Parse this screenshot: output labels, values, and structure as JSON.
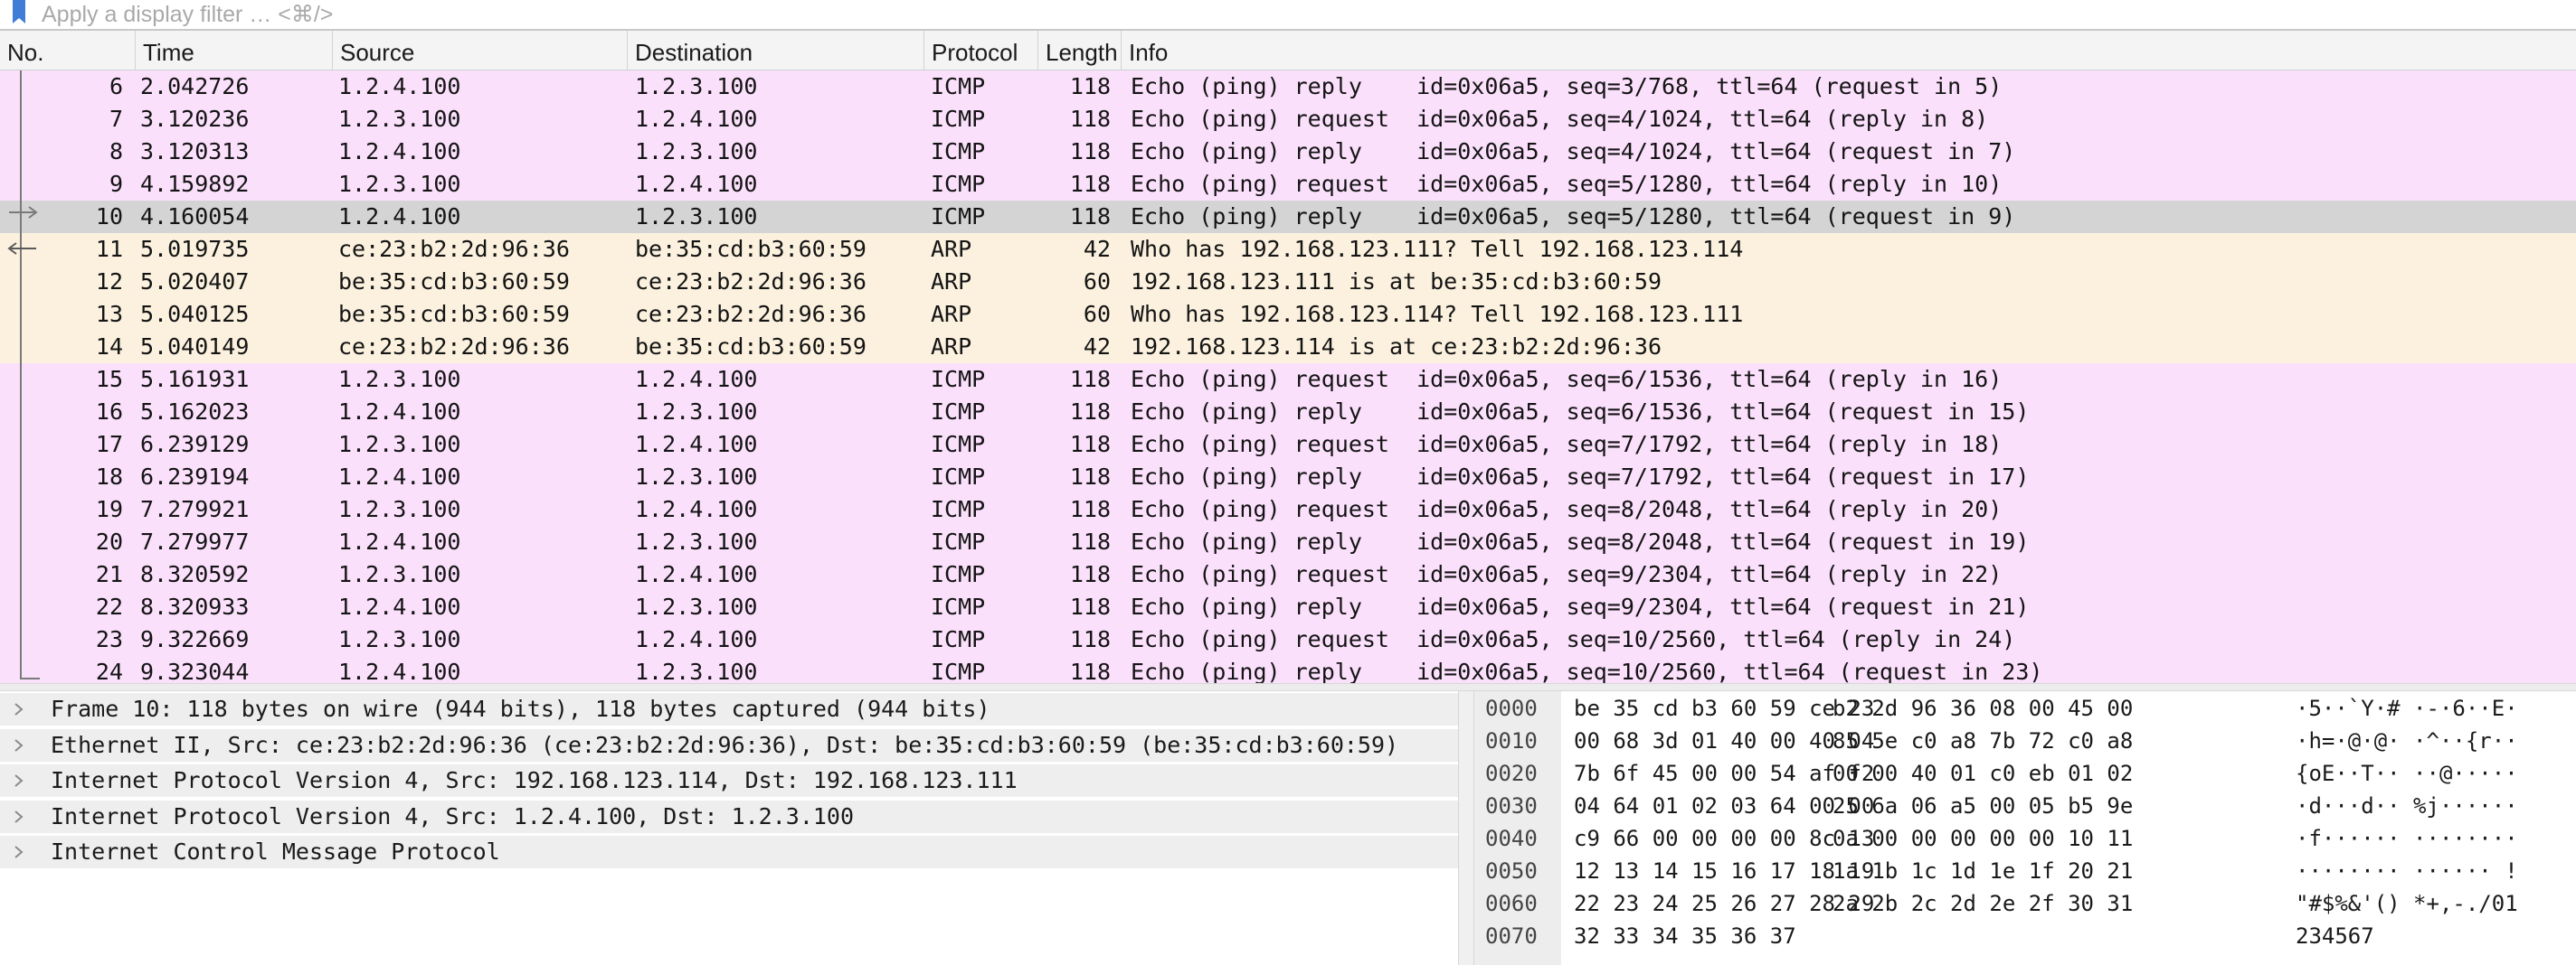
{
  "filter": {
    "placeholder": "Apply a display filter … <⌘/>",
    "bookmark_icon": "bookmark-icon"
  },
  "columns": {
    "no": "No.",
    "time": "Time",
    "source": "Source",
    "destination": "Destination",
    "protocol": "Protocol",
    "length": "Length",
    "info": "Info"
  },
  "colors": {
    "icmp_row": "#fbe0fc",
    "arp_row": "#fbf1de",
    "selected_row": "#d4d4d4"
  },
  "packets": [
    {
      "no": "6",
      "time": "2.042726",
      "src": "1.2.4.100",
      "dst": "1.2.3.100",
      "proto": "ICMP",
      "len": "118",
      "info": "Echo (ping) reply    id=0x06a5, seq=3/768, ttl=64 (request in 5)",
      "type": "icmp"
    },
    {
      "no": "7",
      "time": "3.120236",
      "src": "1.2.3.100",
      "dst": "1.2.4.100",
      "proto": "ICMP",
      "len": "118",
      "info": "Echo (ping) request  id=0x06a5, seq=4/1024, ttl=64 (reply in 8)",
      "type": "icmp"
    },
    {
      "no": "8",
      "time": "3.120313",
      "src": "1.2.4.100",
      "dst": "1.2.3.100",
      "proto": "ICMP",
      "len": "118",
      "info": "Echo (ping) reply    id=0x06a5, seq=4/1024, ttl=64 (request in 7)",
      "type": "icmp"
    },
    {
      "no": "9",
      "time": "4.159892",
      "src": "1.2.3.100",
      "dst": "1.2.4.100",
      "proto": "ICMP",
      "len": "118",
      "info": "Echo (ping) request  id=0x06a5, seq=5/1280, ttl=64 (reply in 10)",
      "type": "icmp"
    },
    {
      "no": "10",
      "time": "4.160054",
      "src": "1.2.4.100",
      "dst": "1.2.3.100",
      "proto": "ICMP",
      "len": "118",
      "info": "Echo (ping) reply    id=0x06a5, seq=5/1280, ttl=64 (request in 9)",
      "type": "selected"
    },
    {
      "no": "11",
      "time": "5.019735",
      "src": "ce:23:b2:2d:96:36",
      "dst": "be:35:cd:b3:60:59",
      "proto": "ARP",
      "len": "42",
      "info": "Who has 192.168.123.111? Tell 192.168.123.114",
      "type": "arp"
    },
    {
      "no": "12",
      "time": "5.020407",
      "src": "be:35:cd:b3:60:59",
      "dst": "ce:23:b2:2d:96:36",
      "proto": "ARP",
      "len": "60",
      "info": "192.168.123.111 is at be:35:cd:b3:60:59",
      "type": "arp"
    },
    {
      "no": "13",
      "time": "5.040125",
      "src": "be:35:cd:b3:60:59",
      "dst": "ce:23:b2:2d:96:36",
      "proto": "ARP",
      "len": "60",
      "info": "Who has 192.168.123.114? Tell 192.168.123.111",
      "type": "arp"
    },
    {
      "no": "14",
      "time": "5.040149",
      "src": "ce:23:b2:2d:96:36",
      "dst": "be:35:cd:b3:60:59",
      "proto": "ARP",
      "len": "42",
      "info": "192.168.123.114 is at ce:23:b2:2d:96:36",
      "type": "arp"
    },
    {
      "no": "15",
      "time": "5.161931",
      "src": "1.2.3.100",
      "dst": "1.2.4.100",
      "proto": "ICMP",
      "len": "118",
      "info": "Echo (ping) request  id=0x06a5, seq=6/1536, ttl=64 (reply in 16)",
      "type": "icmp"
    },
    {
      "no": "16",
      "time": "5.162023",
      "src": "1.2.4.100",
      "dst": "1.2.3.100",
      "proto": "ICMP",
      "len": "118",
      "info": "Echo (ping) reply    id=0x06a5, seq=6/1536, ttl=64 (request in 15)",
      "type": "icmp"
    },
    {
      "no": "17",
      "time": "6.239129",
      "src": "1.2.3.100",
      "dst": "1.2.4.100",
      "proto": "ICMP",
      "len": "118",
      "info": "Echo (ping) request  id=0x06a5, seq=7/1792, ttl=64 (reply in 18)",
      "type": "icmp"
    },
    {
      "no": "18",
      "time": "6.239194",
      "src": "1.2.4.100",
      "dst": "1.2.3.100",
      "proto": "ICMP",
      "len": "118",
      "info": "Echo (ping) reply    id=0x06a5, seq=7/1792, ttl=64 (request in 17)",
      "type": "icmp"
    },
    {
      "no": "19",
      "time": "7.279921",
      "src": "1.2.3.100",
      "dst": "1.2.4.100",
      "proto": "ICMP",
      "len": "118",
      "info": "Echo (ping) request  id=0x06a5, seq=8/2048, ttl=64 (reply in 20)",
      "type": "icmp"
    },
    {
      "no": "20",
      "time": "7.279977",
      "src": "1.2.4.100",
      "dst": "1.2.3.100",
      "proto": "ICMP",
      "len": "118",
      "info": "Echo (ping) reply    id=0x06a5, seq=8/2048, ttl=64 (request in 19)",
      "type": "icmp"
    },
    {
      "no": "21",
      "time": "8.320592",
      "src": "1.2.3.100",
      "dst": "1.2.4.100",
      "proto": "ICMP",
      "len": "118",
      "info": "Echo (ping) request  id=0x06a5, seq=9/2304, ttl=64 (reply in 22)",
      "type": "icmp"
    },
    {
      "no": "22",
      "time": "8.320933",
      "src": "1.2.4.100",
      "dst": "1.2.3.100",
      "proto": "ICMP",
      "len": "118",
      "info": "Echo (ping) reply    id=0x06a5, seq=9/2304, ttl=64 (request in 21)",
      "type": "icmp"
    },
    {
      "no": "23",
      "time": "9.322669",
      "src": "1.2.3.100",
      "dst": "1.2.4.100",
      "proto": "ICMP",
      "len": "118",
      "info": "Echo (ping) request  id=0x06a5, seq=10/2560, ttl=64 (reply in 24)",
      "type": "icmp"
    },
    {
      "no": "24",
      "time": "9.323044",
      "src": "1.2.4.100",
      "dst": "1.2.3.100",
      "proto": "ICMP",
      "len": "118",
      "info": "Echo (ping) reply    id=0x06a5, seq=10/2560, ttl=64 (request in 23)",
      "type": "icmp"
    }
  ],
  "details": [
    "Frame 10: 118 bytes on wire (944 bits), 118 bytes captured (944 bits)",
    "Ethernet II, Src: ce:23:b2:2d:96:36 (ce:23:b2:2d:96:36), Dst: be:35:cd:b3:60:59 (be:35:cd:b3:60:59)",
    "Internet Protocol Version 4, Src: 192.168.123.114, Dst: 192.168.123.111",
    "Internet Protocol Version 4, Src: 1.2.4.100, Dst: 1.2.3.100",
    "Internet Control Message Protocol"
  ],
  "bytes": [
    {
      "offset": "0000",
      "hex1": "be 35 cd b3 60 59 ce 23",
      "hex2": "b2 2d 96 36 08 00 45 00",
      "ascii": "·5··`Y·# ·-·6··E·"
    },
    {
      "offset": "0010",
      "hex1": "00 68 3d 01 40 00 40 04",
      "hex2": "85 5e c0 a8 7b 72 c0 a8",
      "ascii": "·h=·@·@· ·^··{r··"
    },
    {
      "offset": "0020",
      "hex1": "7b 6f 45 00 00 54 af f2",
      "hex2": "00 00 40 01 c0 eb 01 02",
      "ascii": "{oE··T·· ··@·····"
    },
    {
      "offset": "0030",
      "hex1": "04 64 01 02 03 64 00 00",
      "hex2": "25 6a 06 a5 00 05 b5 9e",
      "ascii": "·d···d·· %j······"
    },
    {
      "offset": "0040",
      "hex1": "c9 66 00 00 00 00 8c 13",
      "hex2": "0a 00 00 00 00 00 10 11",
      "ascii": "·f······ ········"
    },
    {
      "offset": "0050",
      "hex1": "12 13 14 15 16 17 18 19",
      "hex2": "1a 1b 1c 1d 1e 1f 20 21",
      "ascii": "········ ······ !"
    },
    {
      "offset": "0060",
      "hex1": "22 23 24 25 26 27 28 29",
      "hex2": "2a 2b 2c 2d 2e 2f 30 31",
      "ascii": "\"#$%&'() *+,-./01"
    },
    {
      "offset": "0070",
      "hex1": "32 33 34 35 36 37",
      "hex2": "",
      "ascii": "234567"
    }
  ]
}
